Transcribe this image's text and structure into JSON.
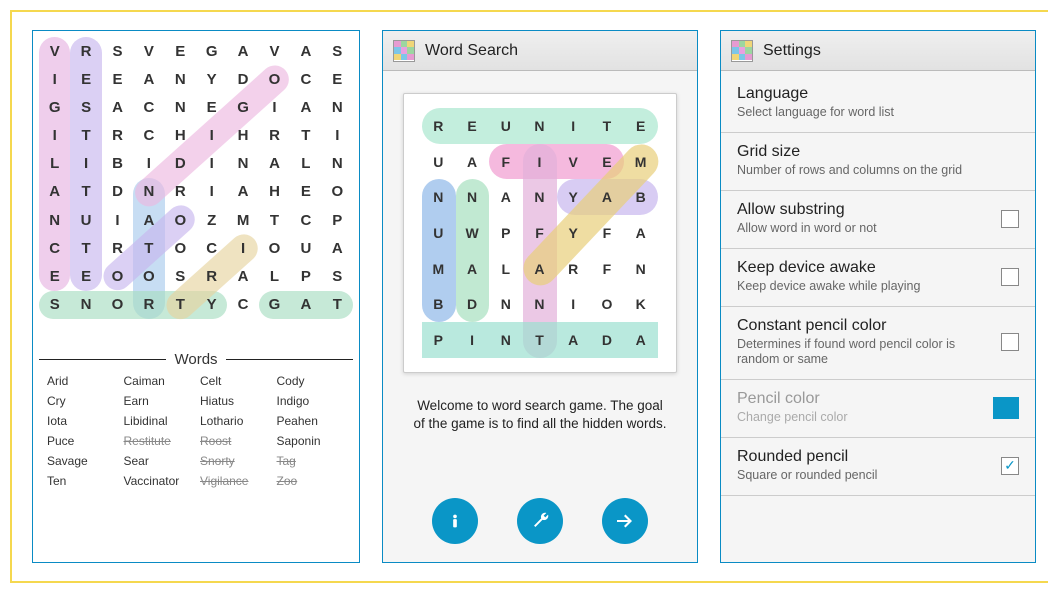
{
  "panel1": {
    "grid": [
      [
        "V",
        "R",
        "S",
        "V",
        "E",
        "G",
        "A",
        "V",
        "A",
        "S"
      ],
      [
        "I",
        "E",
        "E",
        "A",
        "N",
        "Y",
        "D",
        "O",
        "C",
        "E"
      ],
      [
        "G",
        "S",
        "A",
        "C",
        "N",
        "E",
        "G",
        "I",
        "A",
        "N"
      ],
      [
        "I",
        "T",
        "R",
        "C",
        "H",
        "I",
        "H",
        "R",
        "T",
        "I"
      ],
      [
        "L",
        "I",
        "B",
        "I",
        "D",
        "I",
        "N",
        "A",
        "L",
        "N"
      ],
      [
        "A",
        "T",
        "D",
        "N",
        "R",
        "I",
        "A",
        "H",
        "E",
        "O"
      ],
      [
        "N",
        "U",
        "I",
        "A",
        "O",
        "Z",
        "M",
        "T",
        "C",
        "P"
      ],
      [
        "C",
        "T",
        "R",
        "T",
        "O",
        "C",
        "I",
        "O",
        "U",
        "A"
      ],
      [
        "E",
        "E",
        "O",
        "O",
        "S",
        "R",
        "A",
        "L",
        "P",
        "S"
      ],
      [
        "S",
        "N",
        "O",
        "R",
        "T",
        "Y",
        "C",
        "G",
        "A",
        "T"
      ],
      [
        "",
        "",
        "",
        "",
        "",
        "",
        "",
        "",
        "",
        ""
      ]
    ],
    "highlights": [
      {
        "name": "vigilance",
        "color": "#e6b4e2",
        "shape": "vertical",
        "col": 0,
        "row": 0,
        "len": 9
      },
      {
        "name": "restitute",
        "color": "#c7b7ee",
        "shape": "vertical",
        "col": 1,
        "row": 0,
        "len": 9
      },
      {
        "name": "roost",
        "color": "#a9cbed",
        "shape": "vertical",
        "col": 3,
        "row": 5,
        "len": 5
      },
      {
        "name": "snorty",
        "color": "#a8ddc1",
        "shape": "horizontal",
        "col": 0,
        "row": 9,
        "len": 6
      },
      {
        "name": "gat",
        "color": "#a8ddc1",
        "shape": "horizontal",
        "col": 7,
        "row": 9,
        "len": 3
      },
      {
        "name": "diag1",
        "color": "#edb8e0",
        "shape": "diag-ne",
        "colStart": 3,
        "rowStart": 5,
        "colEnd": 7,
        "rowEnd": 1
      },
      {
        "name": "ios",
        "color": "#c7b7ee",
        "shape": "diag-ne",
        "colStart": 2,
        "rowStart": 8,
        "colEnd": 4,
        "rowEnd": 6
      },
      {
        "name": "tag",
        "color": "#e6d4a0",
        "shape": "diag-sw",
        "colStart": 4,
        "rowStart": 9,
        "colEnd": 6,
        "rowEnd": 7
      }
    ],
    "wordsHeader": "Words",
    "words": [
      {
        "t": "Arid",
        "f": false
      },
      {
        "t": "Caiman",
        "f": false
      },
      {
        "t": "Celt",
        "f": false
      },
      {
        "t": "Cody",
        "f": false
      },
      {
        "t": "Cry",
        "f": false
      },
      {
        "t": "Earn",
        "f": false
      },
      {
        "t": "Hiatus",
        "f": false
      },
      {
        "t": "Indigo",
        "f": false
      },
      {
        "t": "Iota",
        "f": false
      },
      {
        "t": "Libidinal",
        "f": false
      },
      {
        "t": "Lothario",
        "f": false
      },
      {
        "t": "Peahen",
        "f": false
      },
      {
        "t": "Puce",
        "f": false
      },
      {
        "t": "Restitute",
        "f": true
      },
      {
        "t": "Roost",
        "f": true
      },
      {
        "t": "Saponin",
        "f": false
      },
      {
        "t": "Savage",
        "f": false
      },
      {
        "t": "Sear",
        "f": false
      },
      {
        "t": "Snorty",
        "f": true
      },
      {
        "t": "Tag",
        "f": true
      },
      {
        "t": "Ten",
        "f": false
      },
      {
        "t": "Vaccinator",
        "f": false
      },
      {
        "t": "Vigilance",
        "f": true
      },
      {
        "t": "Zoo",
        "f": true
      }
    ]
  },
  "panel2": {
    "title": "Word Search",
    "grid": [
      [
        "R",
        "E",
        "U",
        "N",
        "I",
        "T",
        "E"
      ],
      [
        "U",
        "A",
        "F",
        "I",
        "V",
        "E",
        "M"
      ],
      [
        "N",
        "N",
        "A",
        "N",
        "Y",
        "A",
        "B"
      ],
      [
        "U",
        "W",
        "P",
        "F",
        "Y",
        "F",
        "A"
      ],
      [
        "M",
        "A",
        "L",
        "A",
        "R",
        "F",
        "N"
      ],
      [
        "B",
        "D",
        "N",
        "N",
        "I",
        "O",
        "K"
      ],
      [
        "P",
        "I",
        "N",
        "T",
        "A",
        "D",
        "A"
      ]
    ],
    "highlights": [
      {
        "name": "reunite",
        "color": "#a9e7cf",
        "shape": "horizontal",
        "row": 0,
        "col": 0,
        "len": 7,
        "rounded": true
      },
      {
        "name": "five",
        "color": "#f19bd0",
        "shape": "horizontal",
        "row": 1,
        "col": 2,
        "len": 4,
        "rounded": true
      },
      {
        "name": "yab",
        "color": "#c7b7ee",
        "shape": "horizontal",
        "row": 2,
        "col": 4,
        "len": 3,
        "rounded": true
      },
      {
        "name": "numb",
        "color": "#8fb8e8",
        "shape": "vertical",
        "row": 2,
        "col": 0,
        "len": 4,
        "rounded": true
      },
      {
        "name": "nwad",
        "color": "#a6dfbf",
        "shape": "vertical",
        "row": 2,
        "col": 1,
        "len": 4,
        "rounded": true
      },
      {
        "name": "infant",
        "color": "#e3b1da",
        "shape": "vertical",
        "row": 1,
        "col": 3,
        "len": 6,
        "rounded": true
      },
      {
        "name": "pintada",
        "color": "#9be0d0",
        "shape": "horizontal",
        "row": 6,
        "col": 0,
        "len": 7,
        "rounded": false
      },
      {
        "name": "diag",
        "color": "#e8ce7a",
        "shape": "diag-sw",
        "colStart": 6,
        "rowStart": 1,
        "colEnd": 3,
        "rowEnd": 4,
        "rounded": true
      }
    ],
    "welcome": "Welcome to word search game. The goal of the game is to find all the hidden words.",
    "buttons": {
      "info": "info",
      "settings": "settings",
      "play": "play"
    }
  },
  "panel3": {
    "title": "Settings",
    "items": [
      {
        "key": "language",
        "title": "Language",
        "desc": "Select language for word list",
        "control": "none"
      },
      {
        "key": "gridsize",
        "title": "Grid size",
        "desc": "Number of rows and columns on the grid",
        "control": "none"
      },
      {
        "key": "substring",
        "title": "Allow substring",
        "desc": "Allow word in word or not",
        "control": "checkbox",
        "checked": false
      },
      {
        "key": "awake",
        "title": "Keep device awake",
        "desc": "Keep device awake while playing",
        "control": "checkbox",
        "checked": false
      },
      {
        "key": "constcolor",
        "title": "Constant pencil color",
        "desc": "Determines if found word pencil color is random or same",
        "control": "checkbox",
        "checked": false
      },
      {
        "key": "pencilcolor",
        "title": "Pencil color",
        "desc": "Change pencil color",
        "control": "swatch",
        "disabled": true,
        "swatch": "#0a96c7"
      },
      {
        "key": "rounded",
        "title": "Rounded pencil",
        "desc": "Square or rounded pencil",
        "control": "checkbox",
        "checked": true
      }
    ]
  }
}
